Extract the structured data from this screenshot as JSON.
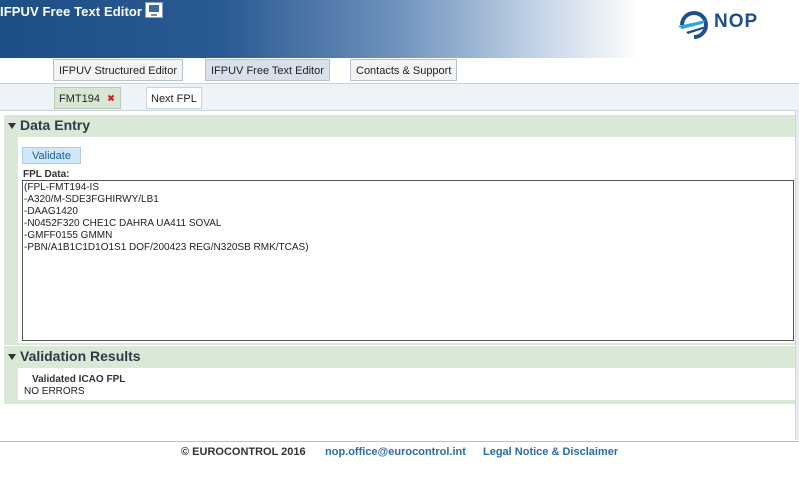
{
  "header": {
    "app_title": "IFPUV Free Text Editor",
    "logo_text": "NOP",
    "colors": {
      "brand_blue": "#1f4f8c",
      "brand_cyan": "#2aa8d8"
    }
  },
  "nav": {
    "tabs": [
      {
        "label": "IFPUV Structured Editor"
      },
      {
        "label": "IFPUV Free Text Editor"
      },
      {
        "label": "Contacts & Support"
      }
    ]
  },
  "fpl_tabs": {
    "tabs": [
      {
        "label": "FMT194",
        "icon": "close-icon"
      },
      {
        "label": "Next FPL"
      }
    ]
  },
  "data_entry": {
    "title": "Data Entry",
    "validate_label": "Validate",
    "fpl_label": "FPL Data:",
    "fpl_lines": [
      "(FPL-FMT194-IS",
      "-A320/M-SDE3FGHIRWY/LB1",
      "-DAAG1420",
      "-N0452F320 CHE1C DAHRA UA411 SOVAL",
      "-GMFF0155 GMMN",
      "-PBN/A1B1C1D1O1S1 DOF/200423 REG/N320SB RMK/TCAS)"
    ]
  },
  "validation": {
    "title": "Validation Results",
    "result_title": "Validated ICAO FPL",
    "result_text": "NO ERRORS"
  },
  "footer": {
    "copyright": "© EUROCONTROL 2016",
    "email": "nop.office@eurocontrol.int",
    "legal": "Legal Notice & Disclaimer"
  }
}
